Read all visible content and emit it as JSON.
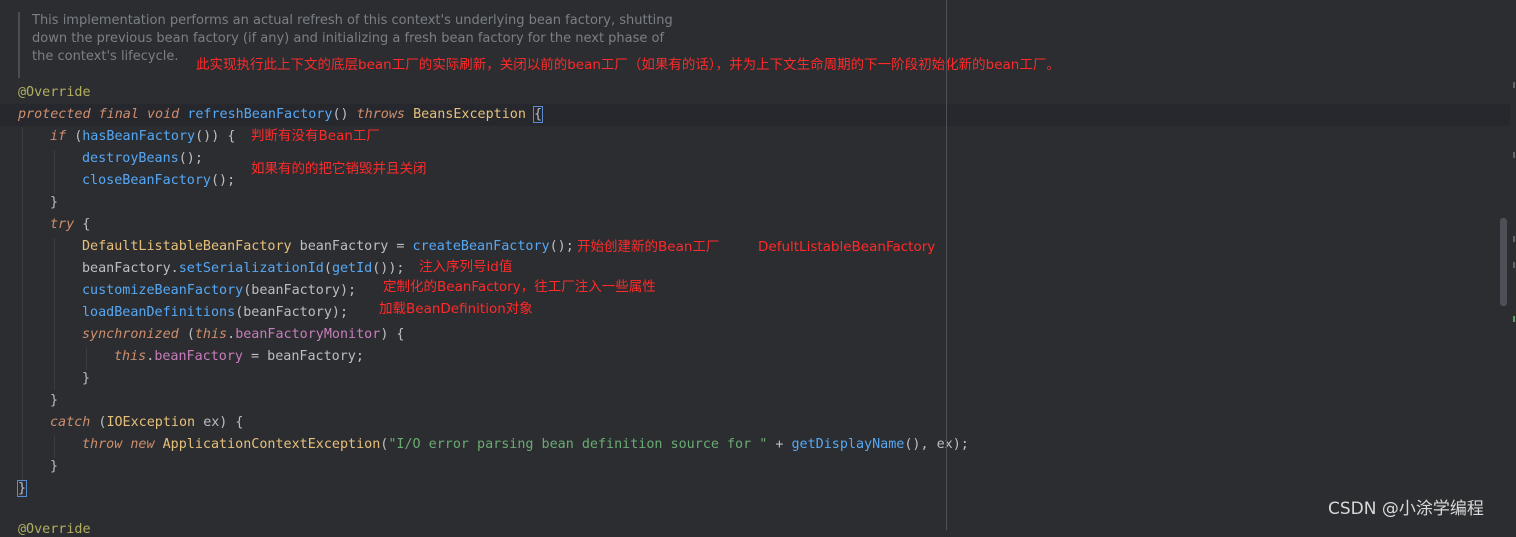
{
  "doc_comment": [
    "This implementation performs an actual refresh of this context's underlying bean factory, shutting",
    "down the previous bean factory (if any) and initializing a fresh bean factory for the next phase of",
    "the context's lifecycle."
  ],
  "code": {
    "l1_annotation": "@Override",
    "l2_kw": "protected final void ",
    "l2_fn": "refreshBeanFactory",
    "l2_paren": "() ",
    "l2_throws": "throws ",
    "l2_type": "BeansException ",
    "l2_brace": "{",
    "l3_kw": "if ",
    "l3_a": "(",
    "l3_fn": "hasBeanFactory",
    "l3_b": "()) {",
    "l4_fn": "destroyBeans",
    "l4_b": "();",
    "l5_fn": "closeBeanFactory",
    "l5_b": "();",
    "l6": "}",
    "l7_kw": "try ",
    "l7_b": "{",
    "l8_type": "DefaultListableBeanFactory ",
    "l8_a": "beanFactory = ",
    "l8_fn": "createBeanFactory",
    "l8_b": "();",
    "l9_a": "beanFactory.",
    "l9_fn": "setSerializationId",
    "l9_b": "(",
    "l9_fn2": "getId",
    "l9_c": "());",
    "l10_fn": "customizeBeanFactory",
    "l10_b": "(beanFactory);",
    "l11_fn": "loadBeanDefinitions",
    "l11_b": "(beanFactory);",
    "l12_kw": "synchronized ",
    "l12_a": "(",
    "l12_kw2": "this",
    "l12_b": ".",
    "l12_field": "beanFactoryMonitor",
    "l12_c": ") {",
    "l13_kw": "this",
    "l13_a": ".",
    "l13_field": "beanFactory",
    "l13_b": " = beanFactory;",
    "l14": "}",
    "l15": "}",
    "l16_kw": "catch ",
    "l16_a": "(",
    "l16_type": "IOException ",
    "l16_b": "ex) {",
    "l17_kw": "throw new ",
    "l17_type": "ApplicationContextException",
    "l17_a": "(",
    "l17_str": "\"I/O error parsing bean definition source for \"",
    "l17_b": " + ",
    "l17_fn": "getDisplayName",
    "l17_c": "(), ex);",
    "l18": "}",
    "l19": "}",
    "l20": "@Override"
  },
  "annotations": {
    "summary": "此实现执行此上下文的底层bean工厂的实际刷新，关闭以前的bean工厂（如果有的话），并为上下文生命周期的下一阶段初始化新的bean工厂。",
    "has_factory": "判断有没有Bean工厂",
    "destroy": "如果有的的把它销毁并且关闭",
    "create": "开始创建新的Bean工厂",
    "create_type": "DefultListableBeanFactory",
    "serialization": "注入序列号id值",
    "customize": "定制化的BeanFactory，往工厂注入一些属性",
    "load": "加载BeanDefinition对象"
  },
  "watermark": "CSDN @小涂学编程",
  "colors": {
    "background": "#2b2d30",
    "keyword": "#cf8e6d",
    "function": "#56a8f5",
    "annotation_text": "#ff2a2a",
    "string": "#6aab73"
  }
}
